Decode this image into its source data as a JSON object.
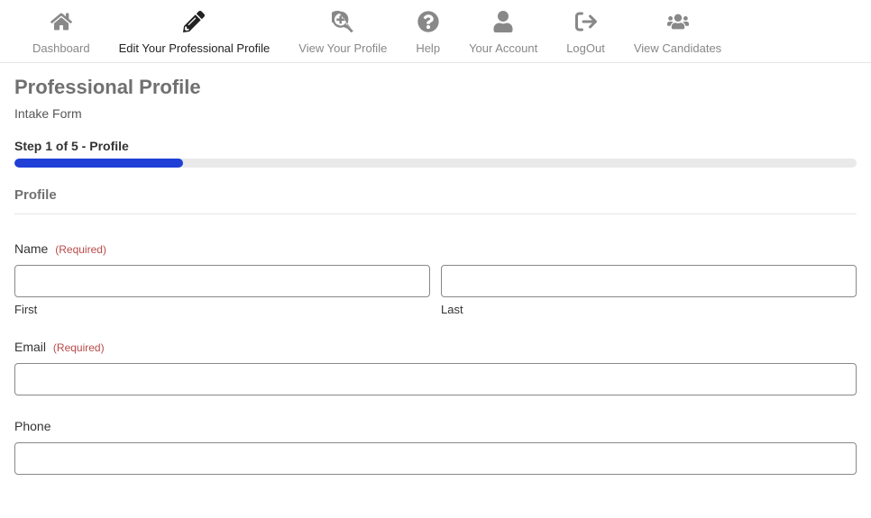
{
  "nav": {
    "items": [
      {
        "label": "Dashboard"
      },
      {
        "label": "Edit Your Professional Profile"
      },
      {
        "label": "View Your Profile"
      },
      {
        "label": "Help"
      },
      {
        "label": "Your Account"
      },
      {
        "label": "LogOut"
      },
      {
        "label": "View Candidates"
      }
    ]
  },
  "page": {
    "title": "Professional Profile",
    "subtitle": "Intake Form"
  },
  "step": {
    "label": "Step 1 of 5 - Profile",
    "percent": 20
  },
  "section": {
    "title": "Profile"
  },
  "form": {
    "name": {
      "label": "Name",
      "required_text": "(Required)",
      "first_value": "",
      "last_value": "",
      "first_sublabel": "First",
      "last_sublabel": "Last"
    },
    "email": {
      "label": "Email",
      "required_text": "(Required)",
      "value": ""
    },
    "phone": {
      "label": "Phone",
      "value": ""
    }
  }
}
